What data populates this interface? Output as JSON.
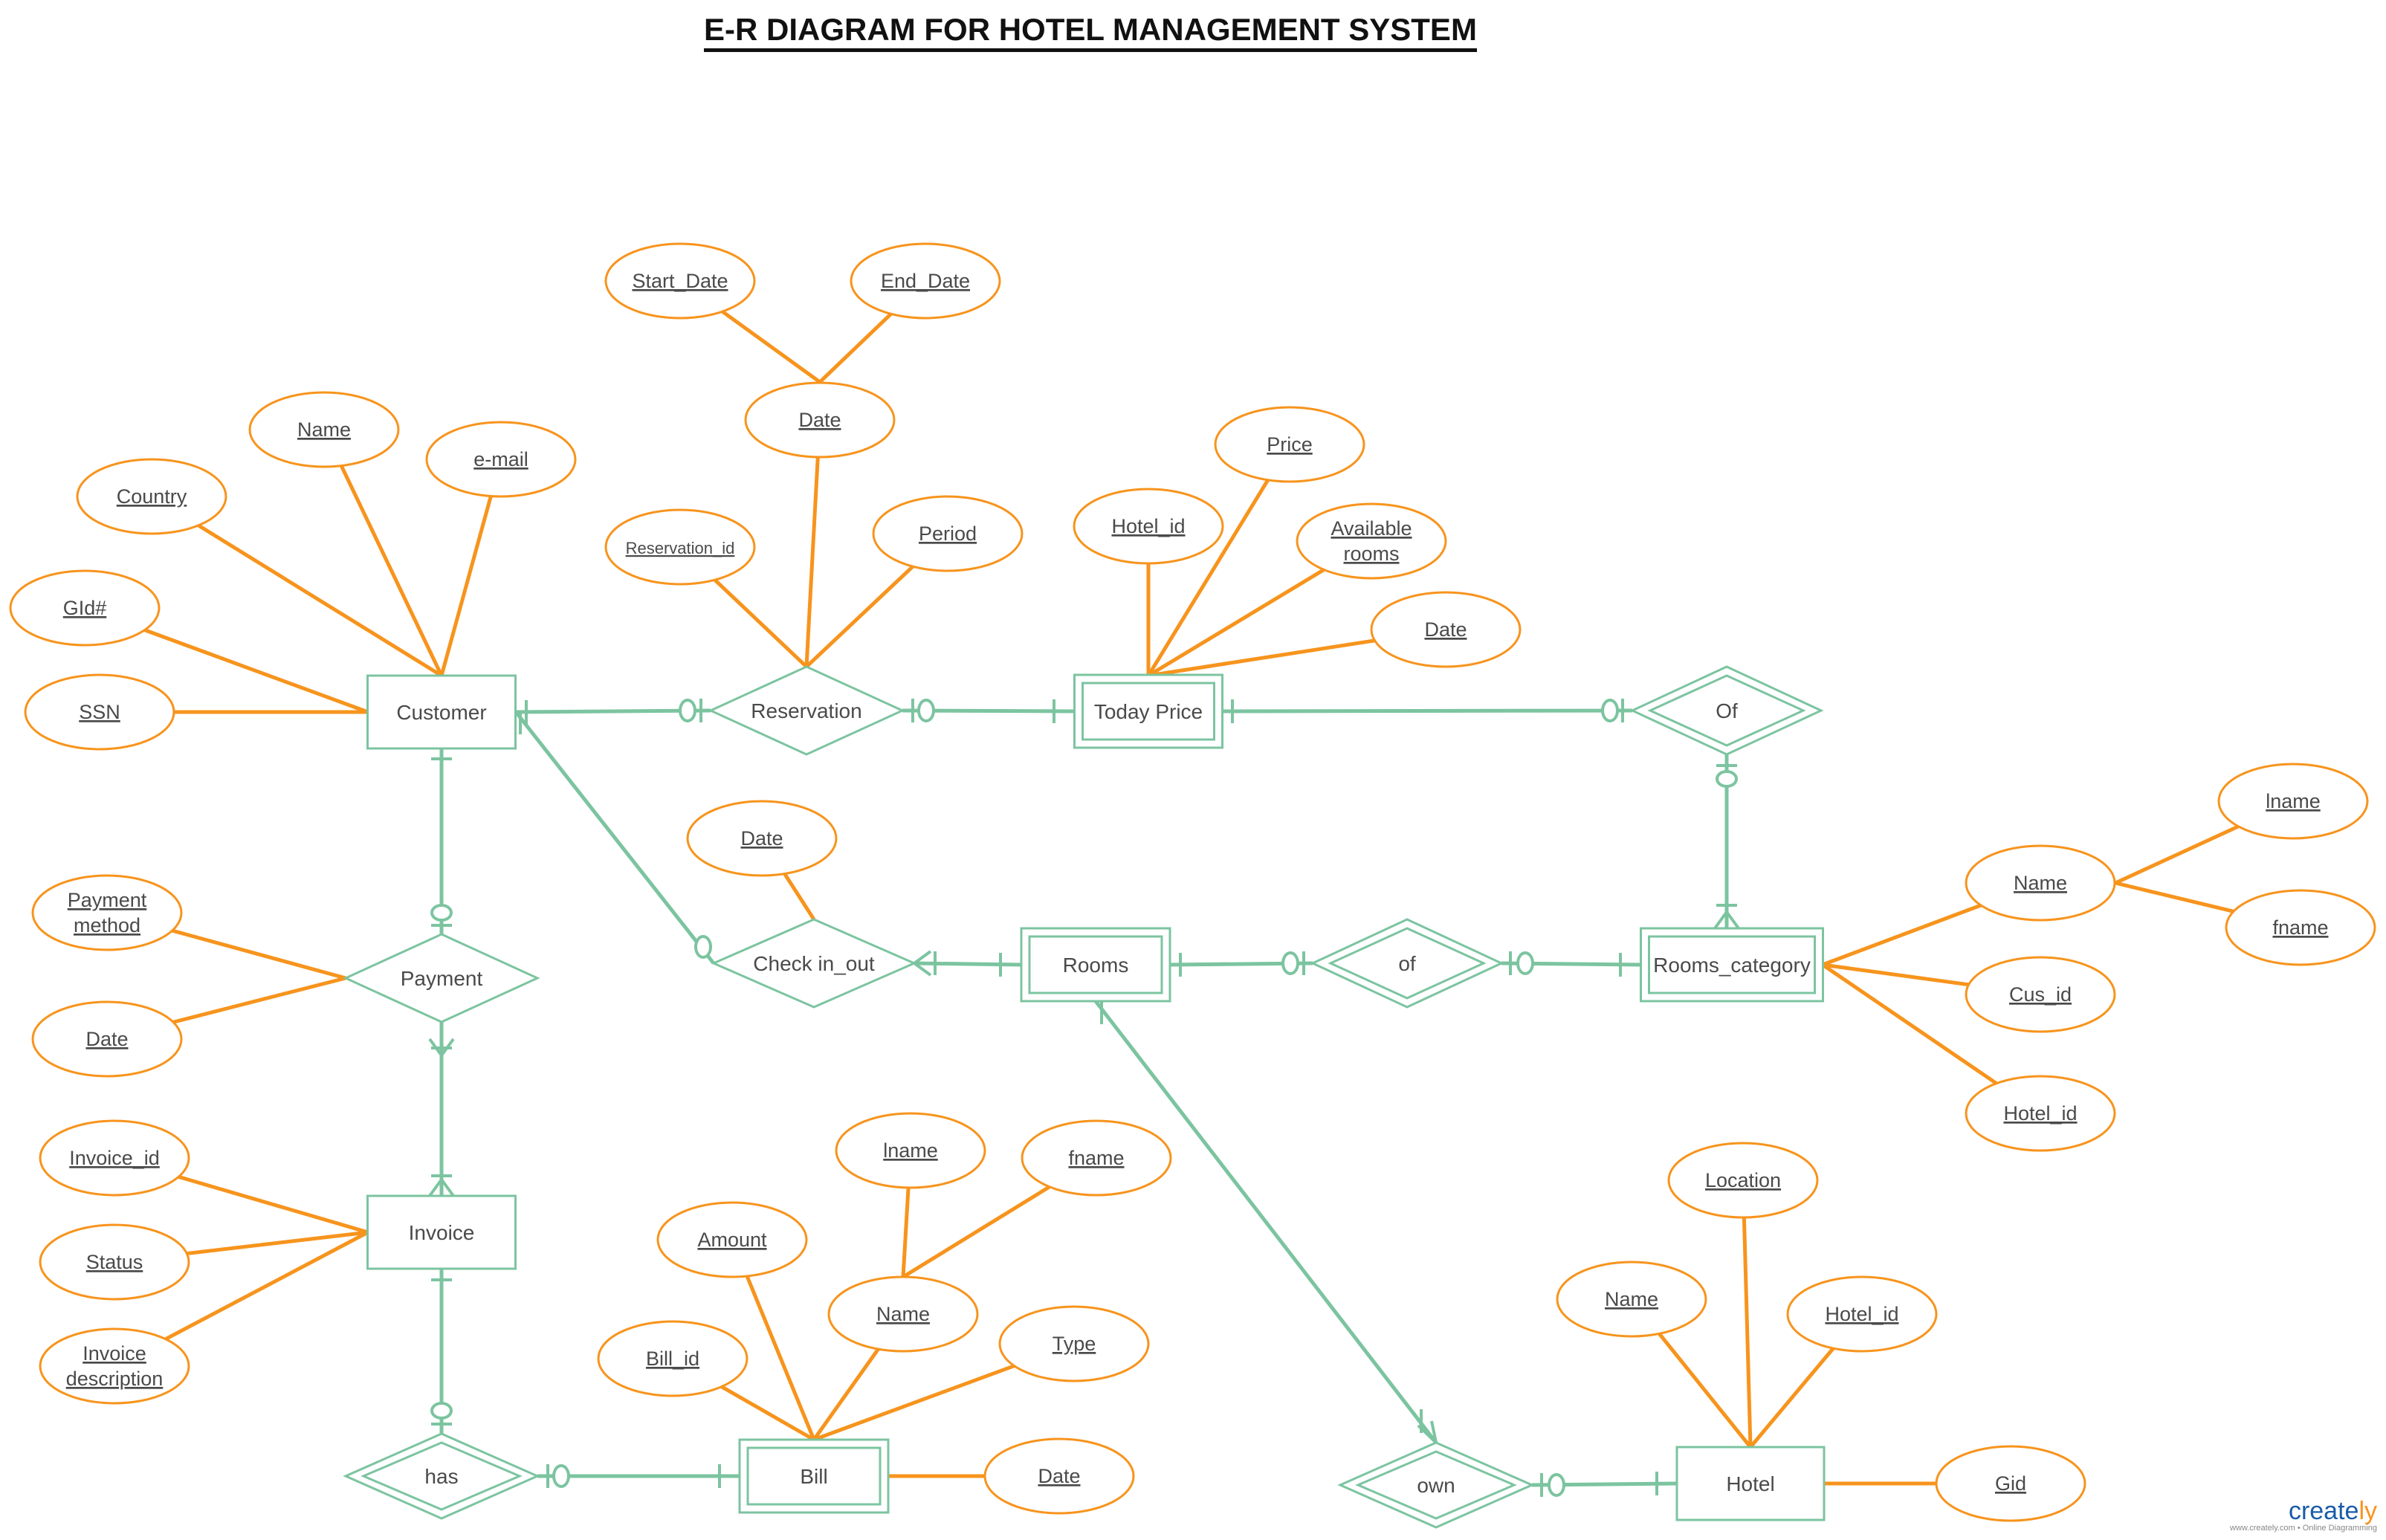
{
  "title": "E-R DIAGRAM FOR HOTEL MANAGEMENT SYSTEM",
  "colors": {
    "entity_stroke": "#7cc4a0",
    "attribute_stroke": "#f7941d",
    "text": "#4a4a4a",
    "title": "#111111"
  },
  "entities": [
    {
      "id": "customer",
      "label": "Customer",
      "weak": false
    },
    {
      "id": "today_price",
      "label": "Today Price",
      "weak": true
    },
    {
      "id": "rooms",
      "label": "Rooms",
      "weak": true
    },
    {
      "id": "rooms_category",
      "label": "Rooms_category",
      "weak": true
    },
    {
      "id": "invoice",
      "label": "Invoice",
      "weak": false
    },
    {
      "id": "bill",
      "label": "Bill",
      "weak": true
    },
    {
      "id": "hotel",
      "label": "Hotel",
      "weak": false
    }
  ],
  "relationships": [
    {
      "id": "reservation",
      "label": "Reservation",
      "identifying": false
    },
    {
      "id": "of_upper",
      "label": "Of",
      "identifying": true
    },
    {
      "id": "check_in_out",
      "label": "Check in_out",
      "identifying": false
    },
    {
      "id": "of_lower",
      "label": "of",
      "identifying": true
    },
    {
      "id": "payment",
      "label": "Payment",
      "identifying": false
    },
    {
      "id": "has",
      "label": "has",
      "identifying": true
    },
    {
      "id": "own",
      "label": "own",
      "identifying": true
    }
  ],
  "attributes": {
    "customer": [
      "Name",
      "e-mail",
      "Country",
      "GId#",
      "SSN"
    ],
    "reservation": [
      "Reservation_id",
      "Period",
      "Date"
    ],
    "reservation_date": [
      "Start_Date",
      "End_Date"
    ],
    "today_price": [
      "Hotel_id",
      "Price",
      "Available rooms",
      "Date"
    ],
    "rooms_category": [
      "Name",
      "Cus_id",
      "Hotel_id"
    ],
    "rooms_category_name": [
      "lname",
      "fname"
    ],
    "check_in_out": [
      "Date"
    ],
    "payment": [
      "Payment method",
      "Date"
    ],
    "invoice": [
      "Invoice_id",
      "Status",
      "Invoice description"
    ],
    "bill": [
      "Bill_id",
      "Amount",
      "Name",
      "Type",
      "Date"
    ],
    "bill_name": [
      "lname",
      "fname"
    ],
    "hotel": [
      "Location",
      "Name",
      "Hotel_id",
      "Gid"
    ]
  },
  "connections": [
    {
      "from": "Customer",
      "to": "Reservation",
      "from_card": "one-only",
      "to_card": "zero-or-one"
    },
    {
      "from": "Reservation",
      "to": "Today Price",
      "from_card": "zero-or-one",
      "to_card": "one-or-many"
    },
    {
      "from": "Today Price",
      "to": "Of",
      "from_card": "one",
      "to_card": "zero-or-one"
    },
    {
      "from": "Of",
      "to": "Rooms_category",
      "from_card": "zero-or-one",
      "to_card": "one-or-many"
    },
    {
      "from": "Customer",
      "to": "Check in_out",
      "from_card": "one",
      "to_card": "zero-or-one"
    },
    {
      "from": "Check in_out",
      "to": "Rooms",
      "from_card": "one-or-many",
      "to_card": "one-or-many"
    },
    {
      "from": "Rooms",
      "to": "of",
      "from_card": "one",
      "to_card": "zero-or-one"
    },
    {
      "from": "of",
      "to": "Rooms_category",
      "from_card": "zero-or-one",
      "to_card": "one-or-many"
    },
    {
      "from": "Customer",
      "to": "Payment",
      "from_card": "one",
      "to_card": "zero-or-one"
    },
    {
      "from": "Payment",
      "to": "Invoice",
      "from_card": "many",
      "to_card": "one-or-many"
    },
    {
      "from": "Invoice",
      "to": "has",
      "from_card": "one",
      "to_card": "zero-or-one"
    },
    {
      "from": "has",
      "to": "Bill",
      "from_card": "zero-or-one",
      "to_card": "one-or-many"
    },
    {
      "from": "Rooms",
      "to": "own",
      "from_card": "one",
      "to_card": "one-or-many"
    },
    {
      "from": "own",
      "to": "Hotel",
      "from_card": "zero-or-one",
      "to_card": "one-or-many"
    }
  ],
  "branding": {
    "logo_main": "create",
    "logo_suffix": "ly",
    "tagline": "www.creately.com • Online Diagramming"
  }
}
